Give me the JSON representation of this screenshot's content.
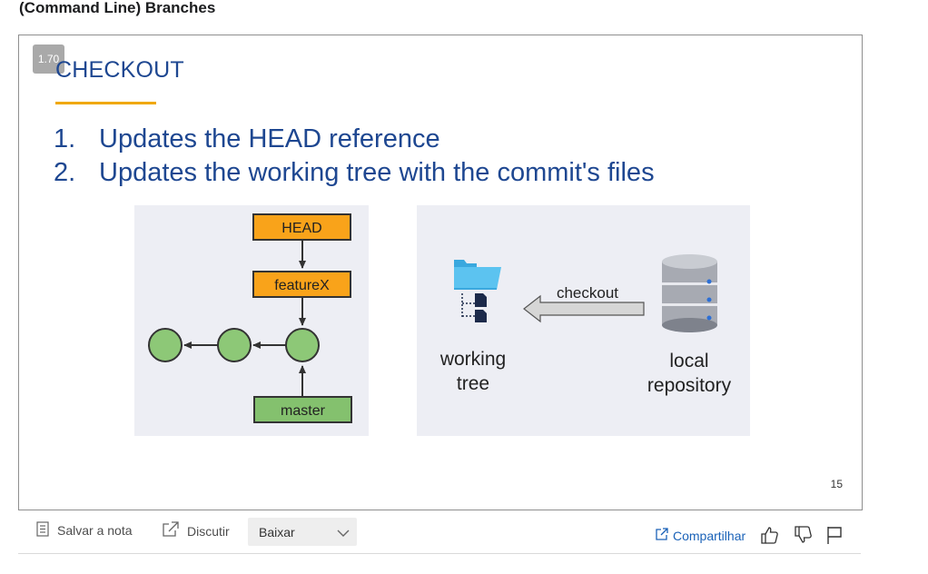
{
  "page": {
    "title": "(Command Line) Branches"
  },
  "player": {
    "speed": "1.70",
    "slide_number": "15"
  },
  "slide": {
    "heading": "CHECKOUT",
    "bullets": [
      {
        "num": "1.",
        "text": "Updates the HEAD reference"
      },
      {
        "num": "2.",
        "text": "Updates the working tree with the commit's files"
      }
    ],
    "left_diagram": {
      "head_label": "HEAD",
      "branch_label": "featureX",
      "master_label": "master",
      "commit_count": 3,
      "colors": {
        "ref_box": "#f9a31a",
        "master_box": "#84c16e",
        "commit": "#8dc877"
      }
    },
    "right_diagram": {
      "arrow_label": "checkout",
      "working_tree_label_line1": "working",
      "working_tree_label_line2": "tree",
      "repo_label_line1": "local",
      "repo_label_line2": "repository",
      "icons": [
        "folder-icon",
        "database-icon"
      ]
    }
  },
  "toolbar": {
    "save_note_label": "Salvar a nota",
    "discuss_label": "Discutir",
    "download_select_value": "Baixar",
    "share_label": "Compartilhar",
    "icons": [
      "note-icon",
      "external-link-icon",
      "chevron-down-icon",
      "share-icon",
      "thumbs-up-icon",
      "thumbs-down-icon",
      "flag-icon"
    ],
    "accent_color": "#1a62b8"
  }
}
